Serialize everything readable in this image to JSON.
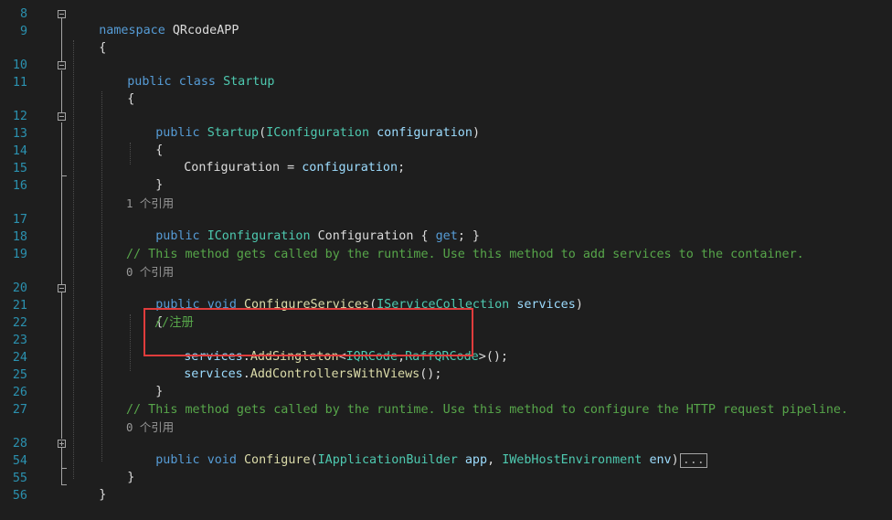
{
  "line_numbers": [
    "8",
    "9",
    "10",
    "11",
    "12",
    "13",
    "14",
    "15",
    "16",
    "17",
    "18",
    "19",
    "20",
    "21",
    "22",
    "23",
    "24",
    "25",
    "26",
    "27",
    "28",
    "54",
    "55",
    "56"
  ],
  "code": {
    "l8": {
      "kw": "namespace",
      "name": "QRcodeAPP"
    },
    "l9": {
      "brace": "{"
    },
    "l10": {
      "kw1": "public",
      "kw2": "class",
      "name": "Startup"
    },
    "l11": {
      "brace": "{"
    },
    "l12": {
      "kw": "public",
      "name": "Startup",
      "open": "(",
      "type": "IConfiguration",
      "param": "configuration",
      "close": ")"
    },
    "l13": {
      "brace": "{"
    },
    "l14": {
      "target": "Configuration",
      "op": " = ",
      "value": "configuration",
      "end": ";"
    },
    "l15": {
      "brace": "}"
    },
    "l17": {
      "kw": "public",
      "type": "IConfiguration",
      "name": "Configuration",
      "open": " { ",
      "get": "get",
      "close": "; }"
    },
    "l19": {
      "comment": "// This method gets called by the runtime. Use this method to add services to the container."
    },
    "l20": {
      "kw1": "public",
      "kw2": "void",
      "name": "ConfigureServices",
      "open": "(",
      "type": "IServiceCollection",
      "param": "services",
      "close": ")"
    },
    "l21": {
      "brace": "{"
    },
    "l22": {
      "comment": "//注册"
    },
    "l23": {
      "obj": "services",
      "dot": ".",
      "method": "AddSingleton",
      "lt": "<",
      "t1": "IQRCode",
      "comma": ",",
      "t2": "RaffQRCode",
      "gt": ">",
      "end": "();"
    },
    "l24": {
      "obj": "services",
      "dot": ".",
      "method": "AddControllersWithViews",
      "end": "();"
    },
    "l25": {
      "brace": "}"
    },
    "l27": {
      "comment": "// This method gets called by the runtime. Use this method to configure the HTTP request pipeline."
    },
    "l28": {
      "kw1": "public",
      "kw2": "void",
      "name": "Configure",
      "open": "(",
      "type1": "IApplicationBuilder",
      "param1": "app",
      "comma": ", ",
      "type2": "IWebHostEnvironment",
      "param2": "env",
      "close": ")",
      "collapsed": "..."
    },
    "l54": {
      "brace": "}"
    },
    "l55": {
      "brace": "}"
    }
  },
  "codelens": {
    "configuration_prop": "1 个引用",
    "configure_services": "0 个引用",
    "configure": "0 个引用"
  },
  "colors": {
    "background": "#1e1e1e",
    "line_number": "#2b91af",
    "keyword": "#569cd6",
    "type": "#4ec9b0",
    "method": "#dcdcaa",
    "parameter": "#9cdcfe",
    "comment": "#57a64a",
    "highlight_box": "#e03c3c"
  }
}
